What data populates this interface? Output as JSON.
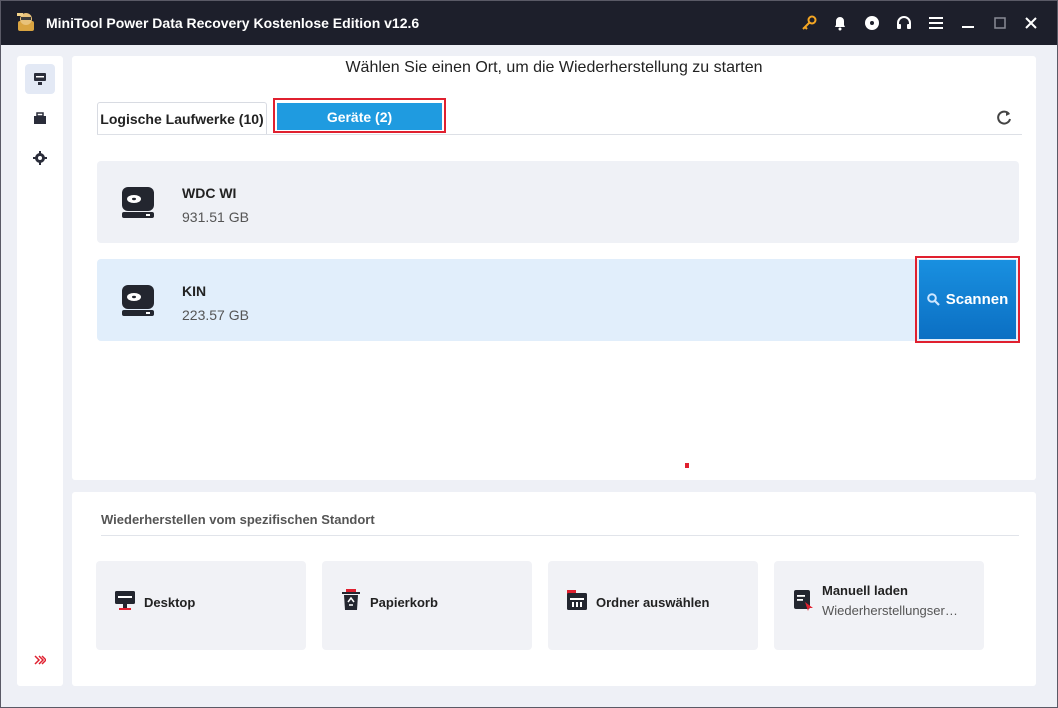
{
  "app": {
    "title": "MiniTool Power Data Recovery Kostenlose Edition v12.6"
  },
  "main": {
    "title": "Wählen Sie einen Ort, um die Wiederherstellung zu starten",
    "tabs": [
      {
        "label": "Logische Laufwerke (10)",
        "selected": false
      },
      {
        "label": "Geräte (2)",
        "selected": true
      }
    ],
    "drives": [
      {
        "name": "WDC WI",
        "size": "931.51 GB"
      },
      {
        "name": "KIN",
        "size": "223.57 GB"
      }
    ],
    "scan_label": "Scannen"
  },
  "specific": {
    "title": "Wiederherstellen vom spezifischen Standort",
    "cards": [
      {
        "label": "Desktop",
        "icon": "desktop-icon"
      },
      {
        "label": "Papierkorb",
        "icon": "recycle-bin-icon"
      },
      {
        "label": "Ordner auswählen",
        "icon": "folder-icon"
      },
      {
        "label": "Manuell laden",
        "sub": "Wiederherstellungser…",
        "icon": "manual-load-icon"
      }
    ]
  },
  "colors": {
    "titlebar": "#1d1f2b",
    "accent": "#1f9be0",
    "highlight": "#e0202f",
    "selected_row": "#e1eefb"
  }
}
